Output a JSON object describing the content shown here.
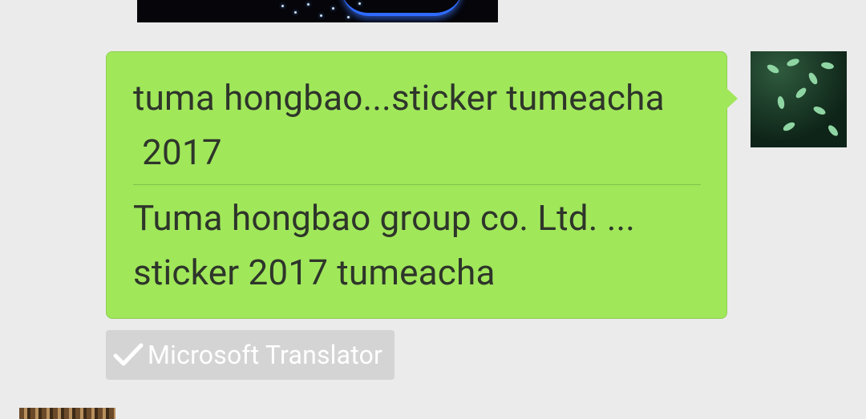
{
  "chat": {
    "message": {
      "original_text": "tuma hongbao...sticker tumeacha\n 2017",
      "translated_text": "Tuma hongbao group co. Ltd. ...\nsticker 2017 tumeacha",
      "bubble_color": "#a0e75a"
    },
    "translator": {
      "label": "Microsoft Translator",
      "icon": "check-icon"
    },
    "avatar": {
      "icon": "avatar-leaves-photo"
    }
  }
}
